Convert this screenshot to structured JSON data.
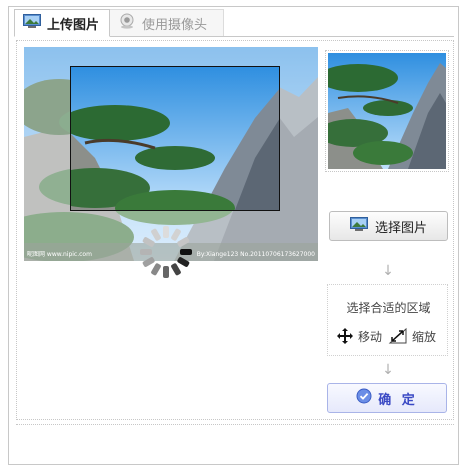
{
  "tabs": [
    {
      "label": "上传图片",
      "icon": "picture-icon",
      "active": true
    },
    {
      "label": "使用摄像头",
      "icon": "webcam-icon",
      "active": false
    }
  ],
  "photo": {
    "credit_left": "昵图网 www.nipic.com",
    "credit_right": "By:Xiange123 No.20110706173627000"
  },
  "buttons": {
    "select_label": "选择图片",
    "confirm_label": "确 定"
  },
  "hint": {
    "title": "选择合适的区域",
    "move_label": "移动",
    "zoom_label": "缩放"
  },
  "arrows": [
    "↓",
    "↓"
  ],
  "colors": {
    "accent": "#3a49c4",
    "border": "#c8c8c8"
  }
}
